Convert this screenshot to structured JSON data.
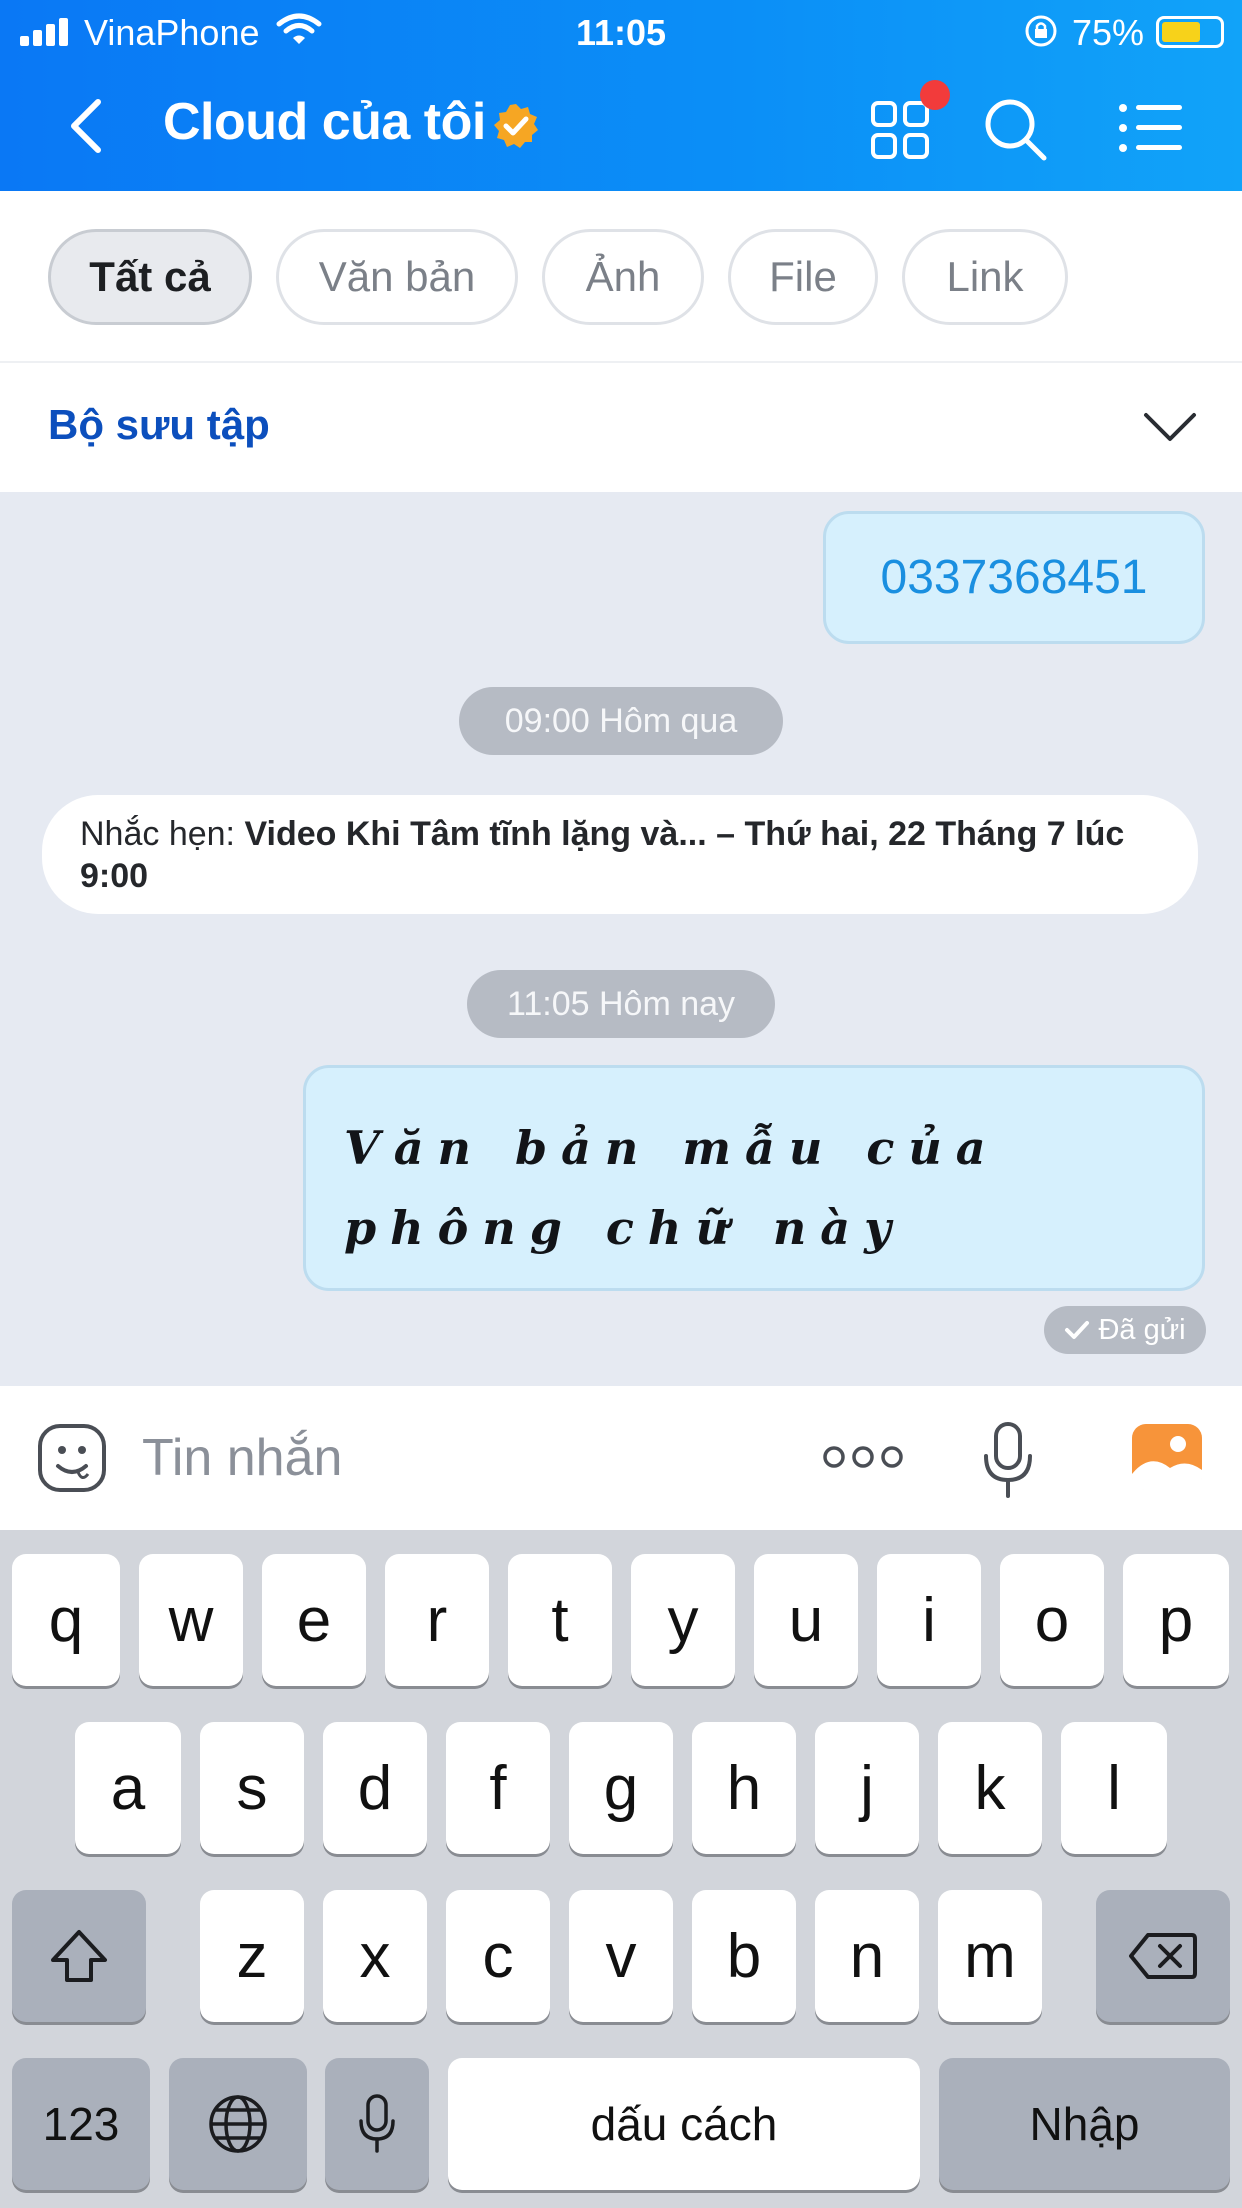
{
  "status_bar": {
    "carrier": "VinaPhone",
    "time": "11:05",
    "battery": "75%"
  },
  "header": {
    "title": "Cloud của tôi"
  },
  "filters": {
    "items": [
      "Tất cả",
      "Văn bản",
      "Ảnh",
      "File",
      "Link"
    ],
    "active": "Tất cả"
  },
  "collection": {
    "label": "Bộ sưu tập"
  },
  "messages": {
    "phone_number": "0337368451",
    "time_yesterday": "09:00 Hôm qua",
    "reminder_prefix": "Nhắc hẹn: ",
    "reminder_detail": "Video Khi Tâm tĩnh lặng và... – Thứ hai, 22 Tháng 7 lúc 9:00",
    "time_today": "11:05 Hôm nay",
    "script_text": "Văn bản mẫu của phông chữ này",
    "sent_status": "Đã gửi"
  },
  "input": {
    "placeholder": "Tin nhắn",
    "more": "ooo"
  },
  "keyboard": {
    "row1": [
      "q",
      "w",
      "e",
      "r",
      "t",
      "y",
      "u",
      "i",
      "o",
      "p"
    ],
    "row2": [
      "a",
      "s",
      "d",
      "f",
      "g",
      "h",
      "j",
      "k",
      "l"
    ],
    "row3": [
      "z",
      "x",
      "c",
      "v",
      "b",
      "n",
      "m"
    ],
    "numbers_key": "123",
    "space_key": "dấu cách",
    "enter_key": "Nhập"
  },
  "colors": {
    "header_blue": "#0a78f5",
    "bubble_bg": "#d6f0fd",
    "link_blue": "#0c4fbd",
    "notification_red": "#f23b3b"
  }
}
